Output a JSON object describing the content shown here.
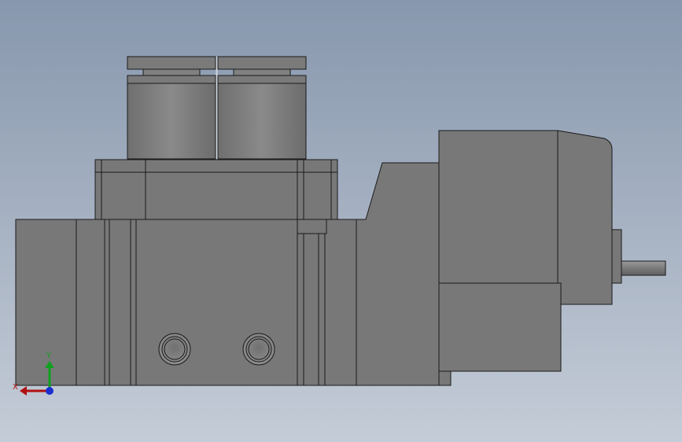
{
  "viewport": {
    "background_top": "#8797ad",
    "background_bottom": "#c4ccd7"
  },
  "model": {
    "body_color": "#787878",
    "edge_color": "#1a1a1a",
    "highlight_color": "#8a8a8a"
  },
  "triad": {
    "x_label": "X",
    "y_label": "Y",
    "x_color": "#b01010",
    "y_color": "#10a020",
    "z_color": "#1a2fd0"
  }
}
